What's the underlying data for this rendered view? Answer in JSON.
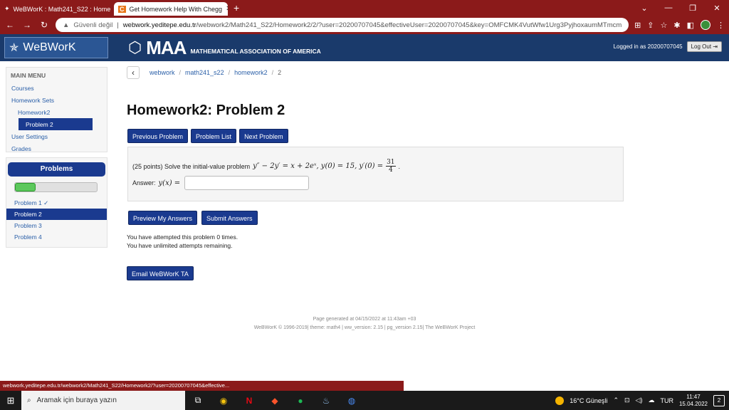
{
  "browser": {
    "tabs": [
      {
        "label": "WeBWorK : Math241_S22 : Home",
        "icon": "webwork-star-icon"
      },
      {
        "label": "Get Homework Help With Chegg",
        "icon": "chegg-c-icon"
      }
    ],
    "address": {
      "security": "Güvenli değil",
      "host": "webwork.yeditepe.edu.tr",
      "path": "/webwork2/Math241_S22/Homework2/2/?user=20200707045&effectiveUser=20200707045&key=OMFCMK4VutWfw1Urg3PyjhoxaumMTmcm"
    },
    "status_url": "webwork.yeditepe.edu.tr/webwork2/Math241_S22/Homework2/?user=20200707045&effective..."
  },
  "header": {
    "logo": "WeBWorK",
    "maa_big": "MAA",
    "maa_sub": "MATHEMATICAL ASSOCIATION OF AMERICA",
    "logged_in": "Logged in as 20200707045",
    "logout": "Log Out"
  },
  "sidebar": {
    "title": "MAIN MENU",
    "items": [
      "Courses",
      "Homework Sets",
      "Homework2",
      "Problem 2",
      "User Settings",
      "Grades"
    ]
  },
  "problems_panel": {
    "title": "Problems",
    "progress_fraction": 0.25,
    "items": [
      "Problem 1 ✓",
      "Problem 2",
      "Problem 3",
      "Problem 4"
    ]
  },
  "breadcrumb": [
    "webwork",
    "math241_s22",
    "homework2",
    "2"
  ],
  "page_title": "Homework2: Problem 2",
  "nav": {
    "prev": "Previous Problem",
    "list": "Problem List",
    "next": "Next Problem"
  },
  "problem": {
    "intro": "(25 points) Solve the initial-value problem",
    "equation": "y″ − 2y′ = x + 2eˣ,  y(0) = 15,  y′(0) =",
    "frac_num": "31",
    "frac_den": "4",
    "answer_label": "Answer:",
    "answer_math": "y(x) =",
    "answer_value": ""
  },
  "actions": {
    "preview": "Preview My Answers",
    "submit": "Submit Answers"
  },
  "attempts": [
    "You have attempted this problem 0 times.",
    "You have unlimited attempts remaining."
  ],
  "email_btn": "Email WeBWorK TA",
  "footer": [
    "Page generated at 04/15/2022 at 11:43am +03",
    "WeBWorK © 1996-2019| theme: math4 | ww_version: 2.15 | pg_version 2.15| The WeBWorK Project"
  ],
  "taskbar": {
    "search_placeholder": "Aramak için buraya yazın",
    "weather": "16°C Güneşli",
    "lang": "TUR",
    "time": "11:47",
    "date": "15.04.2022",
    "notif_count": "2"
  }
}
